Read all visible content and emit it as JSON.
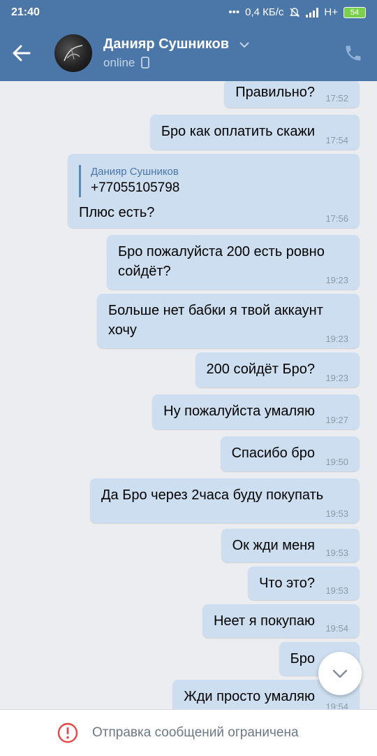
{
  "status_bar": {
    "time": "21:40",
    "network_speed": "0,4 КБ/с",
    "network_type": "H+",
    "battery": "54"
  },
  "header": {
    "contact_name": "Данияр Сушников",
    "status": "online"
  },
  "messages": [
    {
      "text": "Правильно?",
      "time": "17:52"
    },
    {
      "text": "Бро как оплатить скажи",
      "time": "17:54"
    },
    {
      "reply_author": "Данияр Сушников",
      "reply_text": "+77055105798",
      "text": "Плюс есть?",
      "time": "17:56"
    },
    {
      "text": "Бро пожалуйста 200 есть ровно сойдёт?",
      "time": "19:23"
    },
    {
      "text": "Больше нет бабки я твой аккаунт хочу",
      "time": "19:23"
    },
    {
      "text": "200 сойдёт Бро?",
      "time": "19:23"
    },
    {
      "text": "Ну пожалуйста умаляю",
      "time": "19:27"
    },
    {
      "text": "Спасибо бро",
      "time": "19:50"
    },
    {
      "text": "Да Бро через 2часа буду покупать",
      "time": "19:53"
    },
    {
      "text": "Ок жди меня",
      "time": "19:53"
    },
    {
      "text": "Что это?",
      "time": "19:53"
    },
    {
      "text": "Неет я покупаю",
      "time": "19:54"
    },
    {
      "text": "Бро",
      "time": ""
    },
    {
      "text": "Жди просто умаляю",
      "time": "19:54"
    }
  ],
  "bottom_bar": {
    "notice": "Отправка сообщений ограничена"
  },
  "colors": {
    "header_bg": "#4a76a8",
    "bubble_bg": "#ccdef0",
    "chat_bg": "#ebedf0",
    "warning": "#e64646"
  },
  "icons": [
    "back-arrow-icon",
    "dropdown-chevron-icon",
    "mobile-device-icon",
    "phone-icon",
    "chevron-down-icon",
    "warning-icon"
  ]
}
